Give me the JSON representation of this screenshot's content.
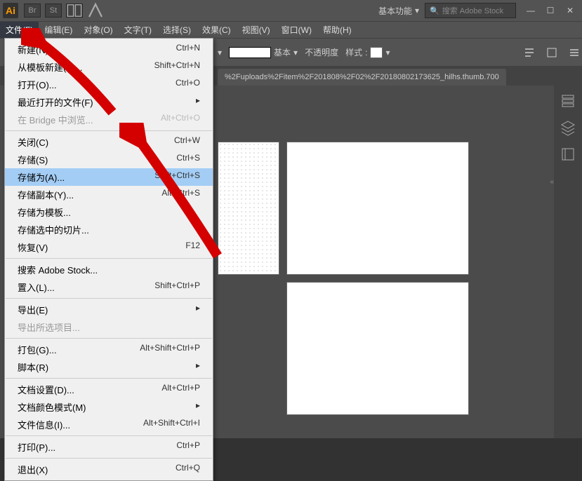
{
  "titlebar": {
    "workspace": "基本功能",
    "search_placeholder": "搜索 Adobe Stock",
    "icons": [
      "Br",
      "St"
    ]
  },
  "menubar": [
    {
      "label": "文件(F)",
      "active": true
    },
    {
      "label": "编辑(E)"
    },
    {
      "label": "对象(O)"
    },
    {
      "label": "文字(T)"
    },
    {
      "label": "选择(S)"
    },
    {
      "label": "效果(C)"
    },
    {
      "label": "视图(V)"
    },
    {
      "label": "窗口(W)"
    },
    {
      "label": "帮助(H)"
    }
  ],
  "optionbar": {
    "stroke_label": "基本",
    "opacity_label": "不透明度",
    "style_label": "样式"
  },
  "doc_tab": "%2Fuploads%2Fitem%2F201808%2F02%2F20180802173625_hilhs.thumb.700",
  "file_menu": [
    {
      "label": "新建(N)...",
      "shortcut": "Ctrl+N"
    },
    {
      "label": "从模板新建(T)...",
      "shortcut": "Shift+Ctrl+N"
    },
    {
      "label": "打开(O)...",
      "shortcut": "Ctrl+O"
    },
    {
      "label": "最近打开的文件(F)",
      "submenu": true
    },
    {
      "label": "在 Bridge 中浏览...",
      "shortcut": "Alt+Ctrl+O",
      "disabled": true
    },
    {
      "sep": true
    },
    {
      "label": "关闭(C)",
      "shortcut": "Ctrl+W"
    },
    {
      "label": "存储(S)",
      "shortcut": "Ctrl+S"
    },
    {
      "label": "存储为(A)...",
      "shortcut": "Shift+Ctrl+S",
      "highlight": true
    },
    {
      "label": "存储副本(Y)...",
      "shortcut": "Alt+Ctrl+S"
    },
    {
      "label": "存储为模板..."
    },
    {
      "label": "存储选中的切片..."
    },
    {
      "label": "恢复(V)",
      "shortcut": "F12"
    },
    {
      "sep": true
    },
    {
      "label": "搜索 Adobe Stock..."
    },
    {
      "label": "置入(L)...",
      "shortcut": "Shift+Ctrl+P"
    },
    {
      "sep": true
    },
    {
      "label": "导出(E)",
      "submenu": true
    },
    {
      "label": "导出所选项目...",
      "disabled": true
    },
    {
      "sep": true
    },
    {
      "label": "打包(G)...",
      "shortcut": "Alt+Shift+Ctrl+P"
    },
    {
      "label": "脚本(R)",
      "submenu": true
    },
    {
      "sep": true
    },
    {
      "label": "文档设置(D)...",
      "shortcut": "Alt+Ctrl+P"
    },
    {
      "label": "文档颜色模式(M)",
      "submenu": true
    },
    {
      "label": "文件信息(I)...",
      "shortcut": "Alt+Shift+Ctrl+I"
    },
    {
      "sep": true
    },
    {
      "label": "打印(P)...",
      "shortcut": "Ctrl+P"
    },
    {
      "sep": true
    },
    {
      "label": "退出(X)",
      "shortcut": "Ctrl+Q"
    }
  ]
}
